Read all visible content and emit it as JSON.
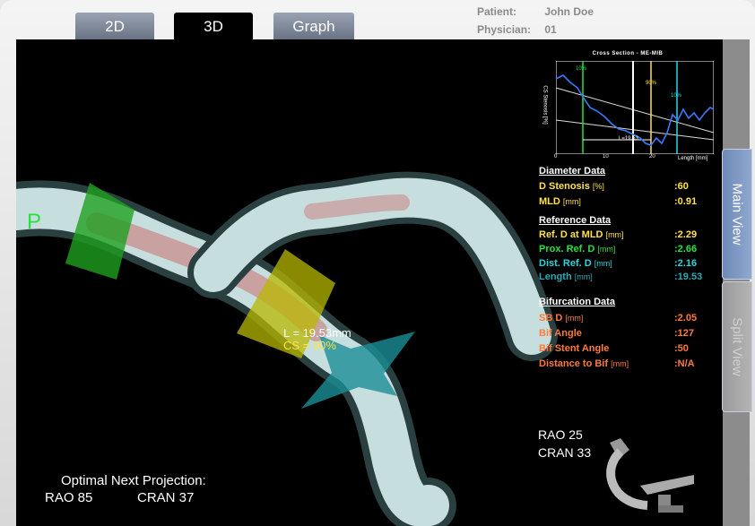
{
  "tabs": {
    "tab_2d": "2D",
    "tab_3d": "3D",
    "tab_graph": "Graph"
  },
  "patient": {
    "patient_label": "Patient:",
    "patient_value": "John Doe",
    "physician_label": "Physician:",
    "physician_value": "01"
  },
  "side_tabs": {
    "main_view": "Main View",
    "split_view": "Split View"
  },
  "cross_section": {
    "title": "Cross Section - ME-MIB",
    "ylabel": "CS Stenosis [%]",
    "xlabel": "Length [mm]",
    "x_ticks": [
      "0",
      "10",
      "20"
    ],
    "marker_left": "10%",
    "marker_mid": "90%",
    "marker_right": "10%",
    "length_marker": "L=19.53"
  },
  "diameter": {
    "header": "Diameter Data",
    "d_stenosis": {
      "label": "D Stenosis",
      "unit": "[%]",
      "value": ":60"
    },
    "mld": {
      "label": "MLD",
      "unit": "[mm]",
      "value": ":0.91"
    }
  },
  "reference": {
    "header": "Reference Data",
    "ref_d_mld": {
      "label": "Ref. D at MLD",
      "unit": "[mm]",
      "value": ":2.29"
    },
    "prox_ref_d": {
      "label": "Prox. Ref. D",
      "unit": "[mm]",
      "value": ":2.66"
    },
    "dist_ref_d": {
      "label": "Dist. Ref. D",
      "unit": "[mm]",
      "value": ":2.16"
    },
    "length": {
      "label": "Length",
      "unit": "[mm]",
      "value": ":19.53"
    }
  },
  "bifurcation": {
    "header": "Bifurcation Data",
    "sb_d": {
      "label": "SB D",
      "unit": "[mm]",
      "value": ":2.05"
    },
    "bif_angle": {
      "label": "Bif Angle",
      "value": ":127"
    },
    "bif_stent_angle": {
      "label": "Bif Stent Angle",
      "value": ":50"
    },
    "distance_to_bif": {
      "label": "Distance to Bif",
      "unit": "[mm]",
      "value": ":N/A"
    }
  },
  "viewport": {
    "p_marker": "P",
    "length_label": "L = 19.53mm",
    "cs_label": "CS = 90%",
    "angle_line1": "RAO 25",
    "angle_line2": "CRAN 33",
    "optimal_title": "Optimal Next Projection:",
    "optimal_rao": "RAO 85",
    "optimal_cran": "CRAN 37"
  },
  "colors": {
    "proximal_marker": "#1fa01f",
    "stenosis_marker": "#b8b800",
    "distal_marker": "#1a8f96",
    "curve": "#3a78ff"
  }
}
